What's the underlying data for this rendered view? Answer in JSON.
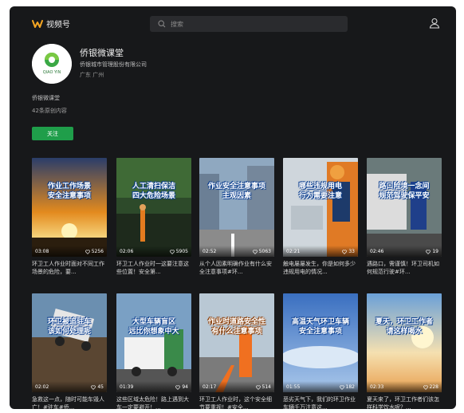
{
  "app": {
    "name": "视频号"
  },
  "search": {
    "placeholder": "搜索"
  },
  "profile": {
    "name": "侨银微课堂",
    "org": "侨银城市管理股份有限公司",
    "region": "广东 广州",
    "desc": "侨银微课堂",
    "count": "42条原创内容",
    "follow": "关注",
    "avatar_text": "QIAO YIN"
  },
  "videos": [
    {
      "title": "作业工作场景\n安全注意事项",
      "duration": "03:08",
      "likes": "5256",
      "caption": "环卫工人作业时面对不同工作场景的危险，要..."
    },
    {
      "title": "人工清扫保洁\n四大危险场景",
      "duration": "02:06",
      "likes": "5905",
      "caption": "环卫工人作业时一这要注意这些位置！安全第..."
    },
    {
      "title": "作业安全注意事项\n主观因素",
      "duration": "02:52",
      "likes": "5063",
      "caption": "从个人因素明确作业有什么安全注意事项#环..."
    },
    {
      "title": "哪些违规用电\n行为需要注意",
      "duration": "02:21",
      "likes": "33",
      "caption": "触电屡屡发生，你是如何多少违规用电的情况..."
    },
    {
      "title": "路口险境一念间\n规范驾驶保平安",
      "duration": "02:46",
      "likes": "19",
      "caption": "遇路口，需谨慎！环卫司机如何规范行驶#环..."
    },
    {
      "title": "环卫被追驻车\n该如何处理呢",
      "duration": "02:02",
      "likes": "45",
      "caption": "急救这一点，随时可能车毁人亡！#驻车#侨..."
    },
    {
      "title": "大型车辆盲区\n远比你想象中大",
      "duration": "01:39",
      "likes": "94",
      "caption": "这些区域太危险！路上遇到大车一定要避开！..."
    },
    {
      "title": "作业时道路安全性\n有什么注意事项",
      "duration": "02:17",
      "likes": "514",
      "caption": "环卫工人作业时，这个安全细节要重视！#安全..."
    },
    {
      "title": "高温天气环卫车辆\n安全注意事项",
      "duration": "01:55",
      "likes": "182",
      "caption": "恶劣天气下，我们的环卫作业车辆千万注意这..."
    },
    {
      "title": "夏天，环卫工作者\n请这样喝水",
      "duration": "02:33",
      "likes": "228",
      "caption": "夏天来了，环卫工作者们该怎样科学饮水呢？..."
    }
  ],
  "colors": {
    "accent": "#1f9e4a",
    "background": "#17181a"
  }
}
